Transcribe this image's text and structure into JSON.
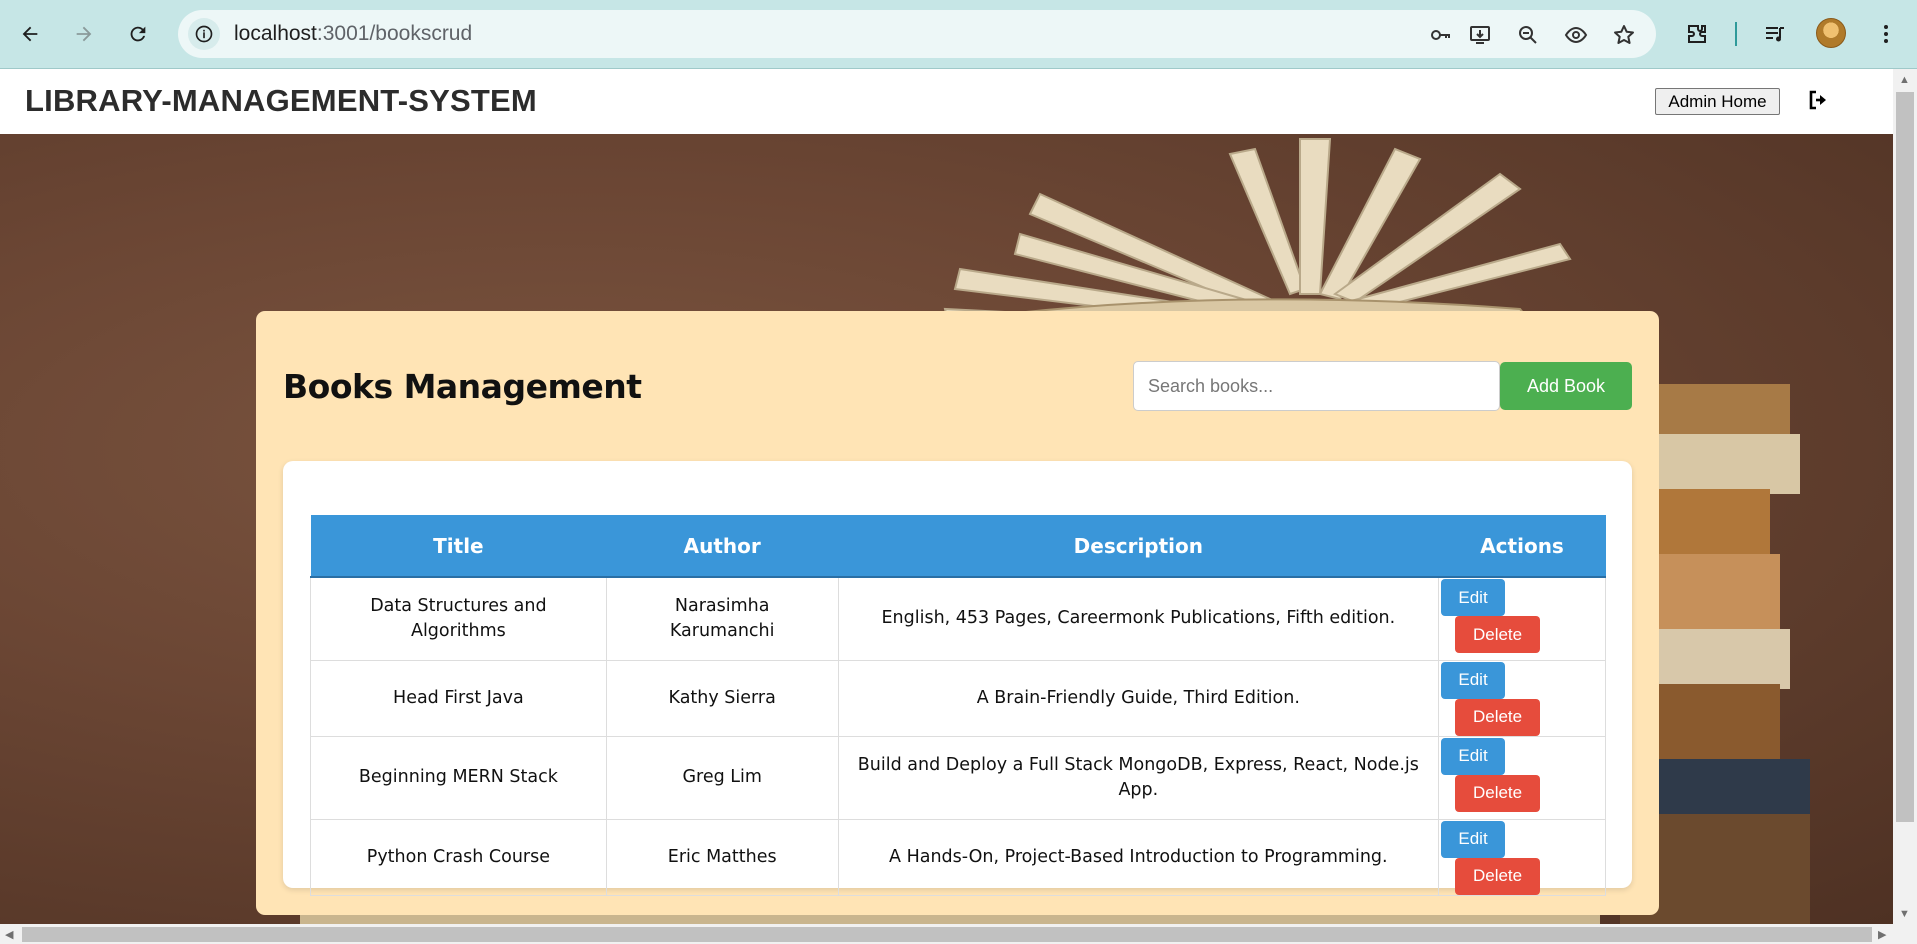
{
  "browser": {
    "url_host": "localhost",
    "url_path": ":3001/bookscrud"
  },
  "header": {
    "app_title": "LIBRARY-MANAGEMENT-SYSTEM",
    "admin_home_label": "Admin Home"
  },
  "panel": {
    "title": "Books Management",
    "search_placeholder": "Search books...",
    "add_button_label": "Add Book"
  },
  "table": {
    "headers": [
      "Title",
      "Author",
      "Description",
      "Actions"
    ],
    "rows": [
      {
        "title": "Data Structures and Algorithms",
        "author": "Narasimha Karumanchi",
        "description": "English, 453 Pages, Careermonk Publications, Fifth edition."
      },
      {
        "title": "Head First Java",
        "author": "Kathy Sierra",
        "description": "A Brain-Friendly Guide, Third Edition."
      },
      {
        "title": "Beginning MERN Stack",
        "author": "Greg Lim",
        "description": "Build and Deploy a Full Stack MongoDB, Express, React, Node.js App."
      },
      {
        "title": "Python Crash Course",
        "author": "Eric Matthes",
        "description": "A Hands-On, Project-Based Introduction to Programming."
      }
    ],
    "edit_label": "Edit",
    "delete_label": "Delete"
  },
  "colors": {
    "panel_bg": "#ffe4b5",
    "header_blue": "#3a96d9",
    "add_green": "#4caf50",
    "delete_red": "#e64c3c"
  }
}
